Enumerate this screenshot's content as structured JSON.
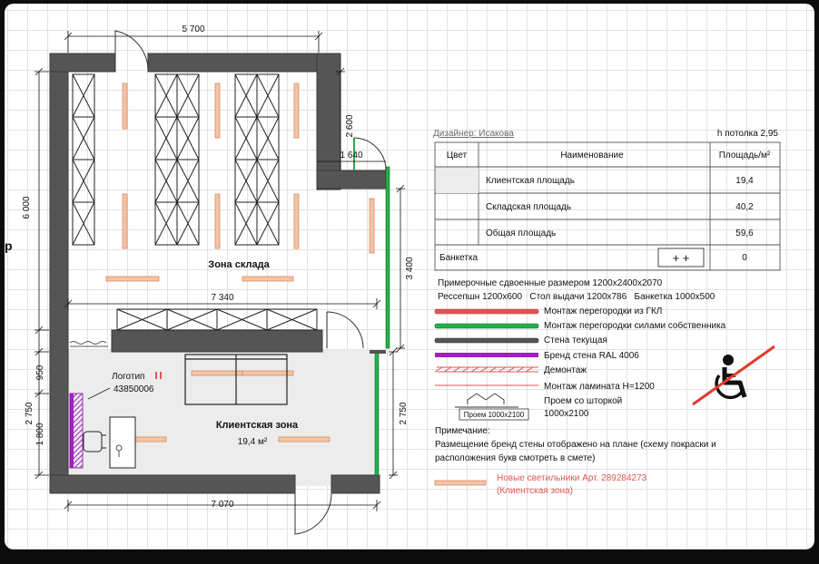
{
  "plan": {
    "dim_top": "5 700",
    "dim_2600": "2 600",
    "dim_1640": "1 640",
    "dim_6000": "6 000",
    "dim_3400": "3 400",
    "dim_7340": "7 340",
    "dim_950": "950",
    "dim_2750_left": "2 750",
    "dim_1800": "1 800",
    "dim_2750_right": "2 750",
    "dim_bottom": "7 070",
    "zone_warehouse": "Зона склада",
    "zone_client": "Клиентская зона",
    "client_area": "19,4 м²",
    "logo_label": "Логотип",
    "logo_code": "43850006"
  },
  "designer": "Дизайнер: Исакова",
  "ceiling": "h потолка 2,95",
  "table": {
    "headers": [
      "Цвет",
      "Наименование",
      "Площадь/м²"
    ],
    "rows": [
      {
        "name": "Клиентская площадь",
        "value": "19,4"
      },
      {
        "name": "Складская площадь",
        "value": "40,2"
      },
      {
        "name": "Общая площадь",
        "value": "59,6"
      }
    ],
    "banquette_label": "Банкетка",
    "banquette_symbol": "+ +",
    "banquette_value": "0"
  },
  "sizes": {
    "line1": "Примерочные сдвоенные размером 1200х2400х2070",
    "line2": "Рессепшн 1200х600   Стол выдачи 1200х786   Банкетка 1000х500"
  },
  "legend": [
    {
      "label": "Монтаж перегородки из ГКЛ",
      "color": "#e05555"
    },
    {
      "label": "Монтаж перегородки силами собственника",
      "color": "#22b04a"
    },
    {
      "label": "Стена текущая",
      "color": "#555555"
    },
    {
      "label": "Бренд стена RAL 4006",
      "color": "#a020c0"
    },
    {
      "label": "Демонтаж",
      "color": "#e05555"
    },
    {
      "label": "Монтаж ламината Н=1200",
      "color": "#e05555"
    }
  ],
  "opening": {
    "symbol_label": "Проем 1000х2100",
    "text1": "Проем со шторкой",
    "text2": "1000х2100"
  },
  "note": {
    "title": "Примечание:",
    "line1": "Размещение бренд стены отображено на плане (схему покраски и",
    "line2": "расположения букв смотреть в смете)"
  },
  "lights": {
    "line1": "Новые светильники Арт. 289284273",
    "line2": "(Клиентская зона)",
    "color": "#e05555"
  },
  "edge_left_char": "р",
  "colors": {
    "wall": "#555555",
    "wall_edge": "#3a3a3a",
    "lamp": "#f3c4a6",
    "lamp_edge": "#d98b5f",
    "brand": "#a020c0",
    "green": "#22b04a",
    "red": "#e05555"
  }
}
